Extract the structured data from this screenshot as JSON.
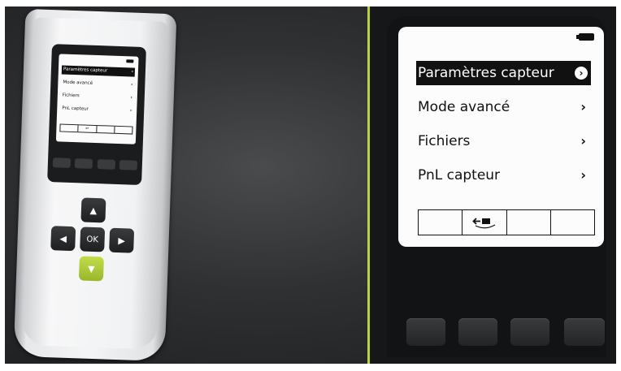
{
  "device": {
    "menu": [
      {
        "label": "Paramètres capteur"
      },
      {
        "label": "Mode avancé"
      },
      {
        "label": "Fichiers"
      },
      {
        "label": "PnL capteur"
      }
    ],
    "dpad": {
      "ok_label": "OK"
    }
  },
  "screen": {
    "menu": [
      {
        "label": "Paramètres capteur",
        "selected": true,
        "icon": "chevron-circle-icon"
      },
      {
        "label": "Mode avancé",
        "selected": false,
        "icon": "chevron-right-icon"
      },
      {
        "label": "Fichiers",
        "selected": false,
        "icon": "chevron-right-icon"
      },
      {
        "label": "PnL capteur",
        "selected": false,
        "icon": "chevron-right-icon"
      }
    ],
    "softkeys": [
      "",
      "back-icon",
      "",
      ""
    ]
  },
  "colors": {
    "accent": "#b8d43a",
    "screen_bg": "#fcfcfc",
    "bezel": "#121314"
  }
}
